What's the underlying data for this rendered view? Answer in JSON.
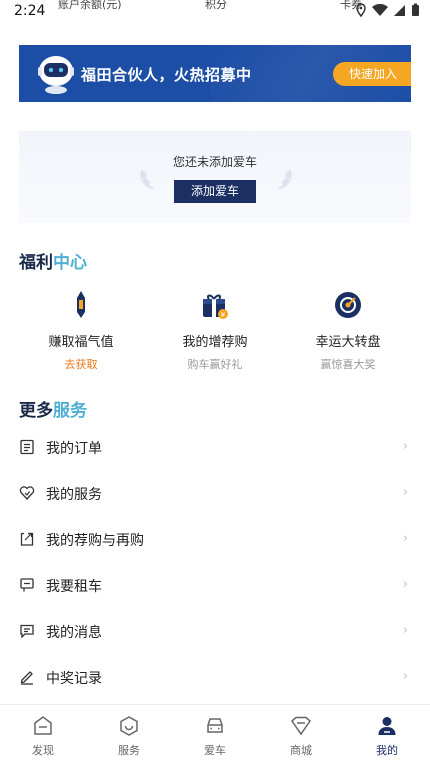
{
  "status_bar": {
    "time": "2:24",
    "clip_account": "账户余额(元)",
    "clip_points": "积分",
    "clip_coupons": "卡券"
  },
  "banner": {
    "text": "福田合伙人，火热招募中",
    "join_label": "快速加入",
    "bg_color": "#1d4ea6",
    "join_color": "#f5a623"
  },
  "car_card": {
    "empty_text": "您还未添加爱车",
    "add_label": "添加爱车"
  },
  "welfare": {
    "title_a": "福利",
    "title_b": "中心",
    "items": [
      {
        "label": "赚取福气值",
        "sub": "去获取",
        "icon": "pen-icon"
      },
      {
        "label": "我的增荐购",
        "sub": "购车赢好礼",
        "icon": "gift-icon"
      },
      {
        "label": "幸运大转盘",
        "sub": "赢惊喜大奖",
        "icon": "target-icon"
      }
    ]
  },
  "more": {
    "title_a": "更多",
    "title_b": "服务",
    "items": [
      {
        "label": "我的订单",
        "icon": "order-icon"
      },
      {
        "label": "我的服务",
        "icon": "service-icon"
      },
      {
        "label": "我的荐购与再购",
        "icon": "share-icon"
      },
      {
        "label": "我要租车",
        "icon": "rent-icon"
      },
      {
        "label": "我的消息",
        "icon": "message-icon"
      },
      {
        "label": "中奖记录",
        "icon": "edit-icon"
      }
    ]
  },
  "tabs": [
    {
      "label": "发现",
      "icon": "discover-icon"
    },
    {
      "label": "服务",
      "icon": "service-tab-icon"
    },
    {
      "label": "爱车",
      "icon": "car-icon"
    },
    {
      "label": "商城",
      "icon": "mall-icon"
    },
    {
      "label": "我的",
      "icon": "profile-icon"
    }
  ],
  "active_tab": "我的",
  "colors": {
    "accent_navy": "#1b2f63",
    "title_highlight": "#4fb0d4",
    "orange": "#e8791d"
  }
}
